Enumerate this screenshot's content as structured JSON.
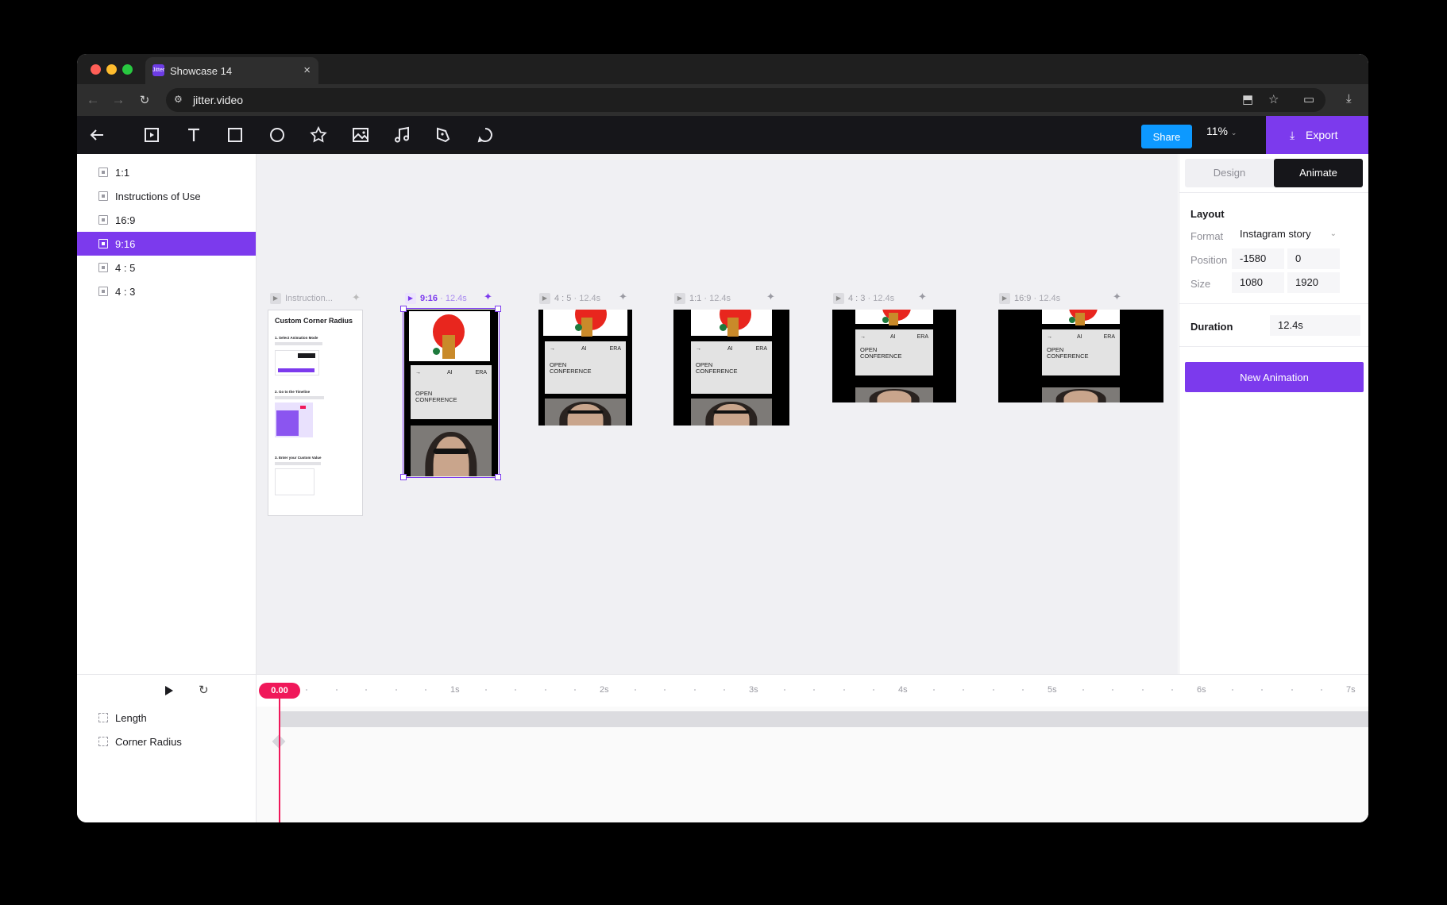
{
  "browser": {
    "tab_title": "Showcase 14",
    "tab_favicon": "Jitter",
    "url": "jitter.video",
    "traffic_lights": [
      "#ff5f57",
      "#febc2e",
      "#28c840"
    ]
  },
  "toolbar": {
    "share_label": "Share",
    "zoom_label": "11%",
    "export_label": "Export",
    "tools": [
      "back-arrow-icon",
      "frame-icon",
      "text-icon",
      "rectangle-icon",
      "ellipse-icon",
      "star-icon",
      "image-icon",
      "music-icon",
      "pen-icon",
      "comment-icon"
    ]
  },
  "layers": [
    {
      "label": "1:1",
      "selected": false
    },
    {
      "label": "Instructions of Use",
      "selected": false
    },
    {
      "label": "16:9",
      "selected": false
    },
    {
      "label": "9:16",
      "selected": true
    },
    {
      "label": "4 : 5",
      "selected": false
    },
    {
      "label": "4 : 3",
      "selected": false
    }
  ],
  "canvas": {
    "frames": [
      {
        "name": "Instruction...",
        "duration": ""
      },
      {
        "name": "9:16",
        "duration": "12.4s"
      },
      {
        "name": "4 : 5",
        "duration": "12.4s"
      },
      {
        "name": "1:1",
        "duration": "12.4s"
      },
      {
        "name": "4 : 3",
        "duration": "12.4s"
      },
      {
        "name": "16:9",
        "duration": "12.4s"
      }
    ],
    "separator": "·",
    "doc": {
      "title": "Custom Corner Radius",
      "step1": "1. Select Animation Mode",
      "step2": "2. Go to the Timeline",
      "step3": "3. Enter your Custom Value"
    },
    "poster": {
      "arrow": "→",
      "ai": "AI",
      "era": "ERA",
      "open": "OPEN",
      "conference": "CONFERENCE"
    }
  },
  "right_panel": {
    "tabs": [
      "Design",
      "Animate"
    ],
    "active_tab": "Animate",
    "layout_title": "Layout",
    "format_label": "Format",
    "format_value": "Instagram story",
    "position_label": "Position",
    "position_x": "-1580",
    "position_y": "0",
    "size_label": "Size",
    "size_w": "1080",
    "size_h": "1920",
    "duration_label": "Duration",
    "duration_value": "12.4s",
    "new_animation_label": "New Animation"
  },
  "timeline": {
    "playhead": "0.00",
    "seconds": [
      "1s",
      "2s",
      "3s",
      "4s",
      "5s",
      "6s",
      "7s"
    ],
    "rows": [
      "Length",
      "Corner Radius"
    ]
  },
  "colors": {
    "accent": "#7c3aed",
    "share": "#0d99ff",
    "playhead": "#f0185a"
  }
}
